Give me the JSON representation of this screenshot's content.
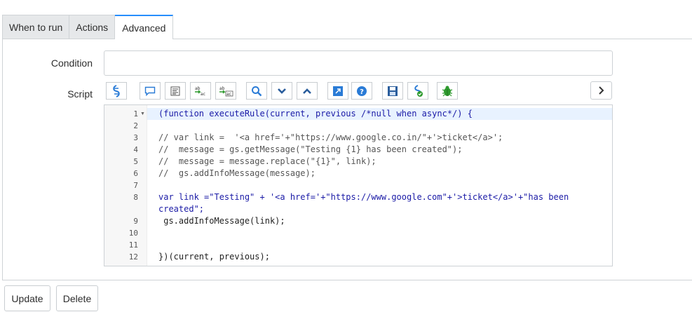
{
  "tabs": [
    {
      "label": "When to run"
    },
    {
      "label": "Actions"
    },
    {
      "label": "Advanced"
    }
  ],
  "active_tab": "Advanced",
  "form": {
    "condition_label": "Condition",
    "condition_value": "",
    "script_label": "Script"
  },
  "toolbar": {
    "icons": [
      "script-include-icon",
      "comment-icon",
      "format-icon",
      "replace-icon",
      "replace-all-icon",
      "search-icon",
      "fold-down-icon",
      "fold-up-icon",
      "fullscreen-icon",
      "help-icon",
      "save-icon",
      "syntax-check-icon",
      "debug-icon",
      "expand-icon"
    ]
  },
  "editor": {
    "lines": [
      {
        "num": "1",
        "text": "(function executeRule(current, previous /*null when async*/) {"
      },
      {
        "num": "2",
        "text": ""
      },
      {
        "num": "3",
        "text": "// var link =  '<a href='+\"https://www.google.co.in/\"+'>ticket</a>';"
      },
      {
        "num": "4",
        "text": "//  message = gs.getMessage(\"Testing {1} has been created\");"
      },
      {
        "num": "5",
        "text": "//  message = message.replace(\"{1}\", link);"
      },
      {
        "num": "6",
        "text": "//  gs.addInfoMessage(message);"
      },
      {
        "num": "7",
        "text": ""
      },
      {
        "num": "8",
        "text": "var link =\"Testing\" + '<a href='+\"https://www.google.com\"+'>ticket</a>'+\"has been"
      },
      {
        "num": "",
        "text": "created\";"
      },
      {
        "num": "9",
        "text": " gs.addInfoMessage(link);"
      },
      {
        "num": "10",
        "text": ""
      },
      {
        "num": "11",
        "text": ""
      },
      {
        "num": "12",
        "text": "})(current, previous);"
      }
    ]
  },
  "buttons": {
    "update": "Update",
    "delete": "Delete"
  }
}
